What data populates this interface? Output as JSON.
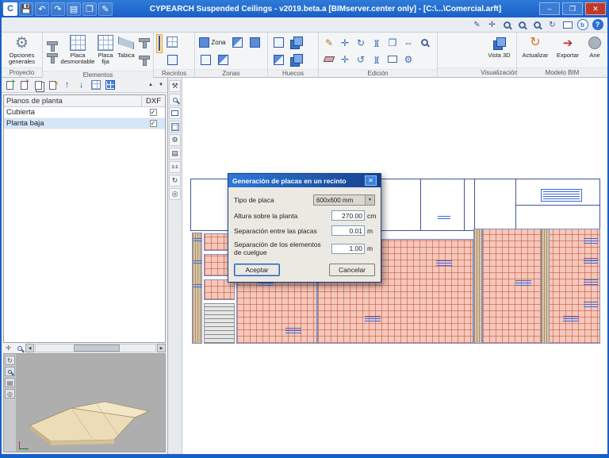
{
  "titlebar": {
    "title": "CYPEARCH Suspended Ceilings - v2019.beta.a [BIMserver.center only] - [C:\\...\\Comercial.arft]"
  },
  "icons": {
    "app": "C",
    "save": "💾",
    "undo": "↶",
    "redo": "↷",
    "print": "▤",
    "copy": "❐",
    "editdoc": "✎",
    "minimize": "–",
    "maximize": "❐",
    "close": "✕",
    "help": "?",
    "bim": "b",
    "pan": "✛",
    "refresh": "↻",
    "pencil": "✎",
    "move": "✛",
    "rotate_cw": "↻",
    "rotate_ccw": "↺",
    "mirror": "][",
    "resize": "⇔",
    "gear": "⚙",
    "tools": "⚒",
    "layers": "▤",
    "target": "◎",
    "zoom11": "1:1",
    "up": "↑",
    "down": "↓",
    "left": "◀",
    "right": "▶",
    "sort_up": "▲",
    "sort_down": "▼",
    "check": "✓",
    "dd_arrow": "▼",
    "export": "➔"
  },
  "ribbon": {
    "proyecto": {
      "label": "Proyecto",
      "opciones_generales": "Opciones generales"
    },
    "elementos": {
      "label": "Elementos",
      "placa_desmontable": "Placa desmontable",
      "placa_fija": "Placa fija",
      "tabica": "Tabica"
    },
    "recintos": {
      "label": "Recintos"
    },
    "zonas": {
      "label": "Zonas",
      "zona": "Zona"
    },
    "huecos": {
      "label": "Huecos"
    },
    "edicion": {
      "label": "Edición"
    },
    "visualizacion": {
      "label": "Visualización",
      "vista_3d": "Vista 3D"
    },
    "modelo_bim": {
      "label": "Modelo BIM",
      "actualizar": "Actualizar",
      "exportar": "Exportar",
      "ane": "Ane"
    }
  },
  "left_panel": {
    "header": "Planos de planta",
    "dxf": "DXF",
    "rows": [
      {
        "name": "Cubierta"
      },
      {
        "name": "Planta baja"
      }
    ]
  },
  "dialog": {
    "title": "Generación de placas en un recinto",
    "tipo_de_placa": {
      "label": "Tipo de placa",
      "value": "600x600 mm"
    },
    "altura": {
      "label": "Altura sobre la planta",
      "value": "270.00",
      "unit": "cm"
    },
    "sep_placas": {
      "label": "Separación entre las placas",
      "value": "0.01",
      "unit": "m"
    },
    "sep_cuelgue": {
      "label": "Separación de los elementos de cuelgue",
      "value": "1.00",
      "unit": "m"
    },
    "aceptar": "Aceptar",
    "cancelar": "Cancelar"
  }
}
